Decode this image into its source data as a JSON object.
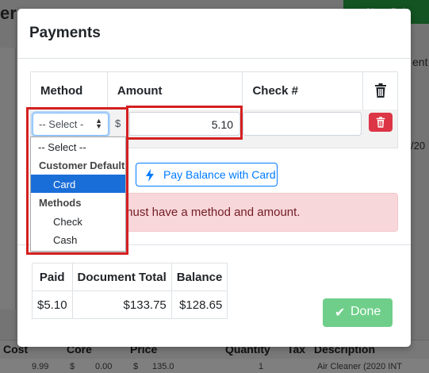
{
  "background": {
    "title_fragment": "er",
    "new_button": "+ New Sale",
    "right_label": "ent",
    "right_date": "/20",
    "table_headers": [
      "Cost",
      "Core",
      "Price",
      "Quantity",
      "Tax",
      "Description"
    ],
    "row_values": [
      "9.99",
      "$",
      "0.00",
      "$",
      "135.0",
      "1",
      "Air Cleaner (2020 INT"
    ]
  },
  "modal": {
    "title": "Payments",
    "headers": {
      "method": "Method",
      "amount": "Amount",
      "check": "Check #"
    },
    "method_select": {
      "value": "-- Select -",
      "options": {
        "placeholder": "-- Select --",
        "group1": "Customer Default",
        "card": "Card",
        "group2": "Methods",
        "check": "Check",
        "cash": "Cash"
      }
    },
    "currency_symbol": "$",
    "amount_value": "5.10",
    "check_value": "",
    "pay_balance_label": "Pay Balance with Card",
    "alert_text": "must have a method and amount.",
    "totals": {
      "headers": [
        "Paid",
        "Document Total",
        "Balance"
      ],
      "values": [
        "$5.10",
        "$133.75",
        "$128.65"
      ]
    },
    "done_label": "Done"
  },
  "colors": {
    "accent": "#007bff",
    "danger": "#dc3545",
    "success_disabled": "#6fcf8a",
    "selected_option": "#1a6ed8",
    "annotation": "#d42020"
  },
  "icons": {
    "trash": "trash-icon",
    "bolt": "bolt-icon",
    "check": "checkmark-icon"
  }
}
